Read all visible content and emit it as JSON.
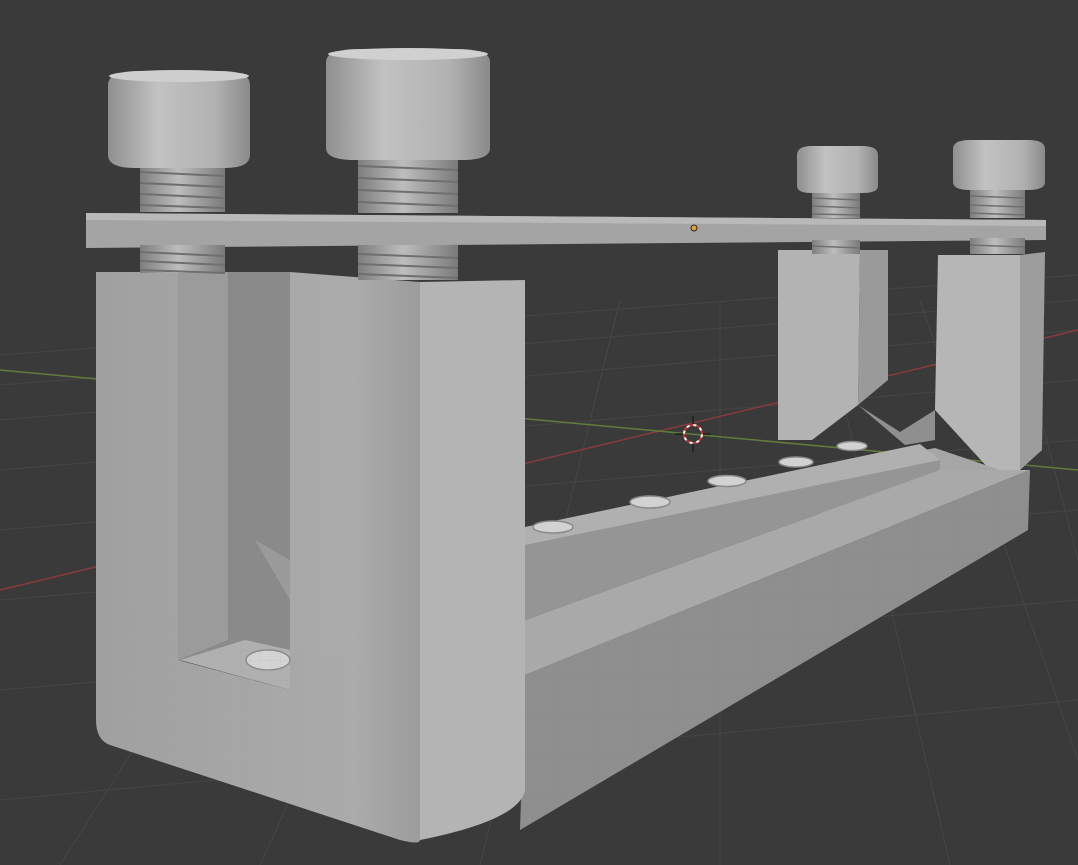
{
  "viewport": {
    "type": "3d-viewport",
    "background_color": "#3a3a3a",
    "grid_color": "#464646",
    "x_axis_color": "#8a3a3a",
    "y_axis_color": "#5e7d3a",
    "object": {
      "description_icon": "clamp-fixture-mesh",
      "surface_color": "#a9a9a9",
      "shadow_color": "#7b7b7b",
      "highlight_color": "#c4c4c4",
      "screws": 4,
      "rail_holes": 6
    },
    "origin_dot_color": "#e0a030",
    "cursor_icon": "3d-cursor-icon"
  }
}
